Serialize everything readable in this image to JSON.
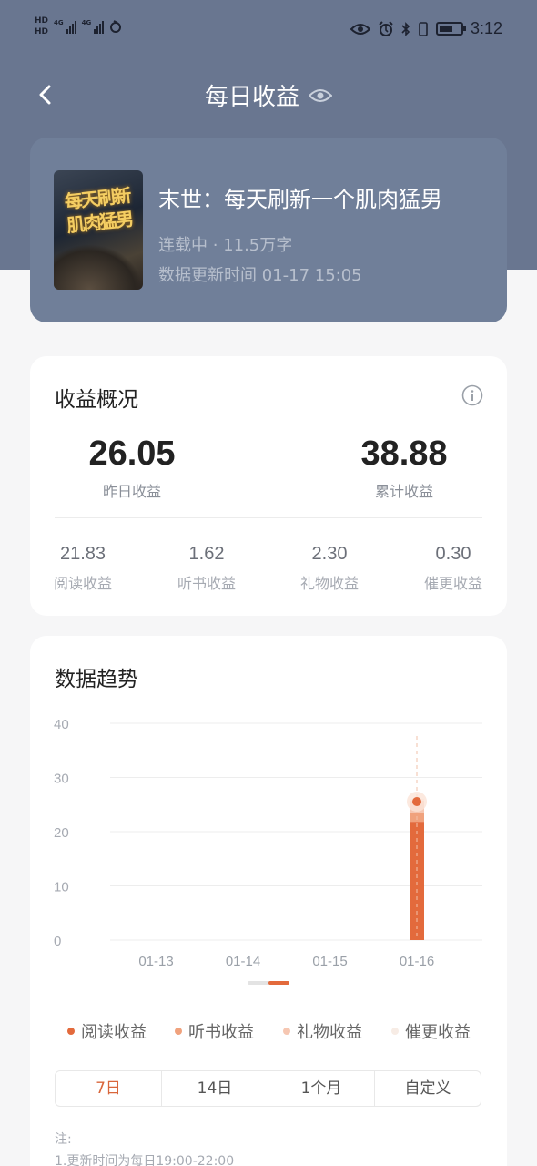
{
  "status_bar": {
    "network": [
      "HD",
      "HD"
    ],
    "sig1_label": "4G",
    "sig2_label": "4G",
    "time": "3:12",
    "icons": [
      "eye-icon",
      "alarm-icon",
      "bluetooth-icon",
      "vibrate-icon",
      "battery-icon"
    ]
  },
  "header": {
    "back_icon": "chevron-left-icon",
    "title": "每日收益",
    "title_icon": "eye-icon"
  },
  "book": {
    "title": "末世：每天刷新一个肌肉猛男",
    "status": "连载中 · 11.5万字",
    "updated": "数据更新时间 01-17 15:05",
    "cover_text": "每天刷新肌肉猛男"
  },
  "summary": {
    "title": "收益概况",
    "info_icon": "info-icon",
    "yesterday": {
      "value": "26.05",
      "label": "昨日收益"
    },
    "total": {
      "value": "38.88",
      "label": "累计收益"
    },
    "breakdown": [
      {
        "value": "21.83",
        "label": "阅读收益"
      },
      {
        "value": "1.62",
        "label": "听书收益"
      },
      {
        "value": "2.30",
        "label": "礼物收益"
      },
      {
        "value": "0.30",
        "label": "催更收益"
      }
    ]
  },
  "trend": {
    "title": "数据趋势",
    "tabs": [
      "7日",
      "14日",
      "1个月",
      "自定义"
    ],
    "active_tab": 0,
    "note_title": "注:",
    "note_line1": "1.更新时间为每日19:00-22:00"
  },
  "colors": {
    "header_bg": "#697690",
    "accent": "#d9663b",
    "read": "#e36a3c",
    "listen": "#f0a27d",
    "gift": "#f6c7b2",
    "urge": "#f7ece5"
  },
  "chart_data": {
    "type": "bar",
    "stacked": true,
    "categories": [
      "01-13",
      "01-14",
      "01-15",
      "01-16"
    ],
    "ylim": [
      0,
      40
    ],
    "yticks": [
      0,
      10,
      20,
      30,
      40
    ],
    "series": [
      {
        "name": "阅读收益",
        "color": "#e36a3c",
        "values": [
          0,
          0,
          0,
          21.83
        ]
      },
      {
        "name": "听书收益",
        "color": "#f0a27d",
        "values": [
          0,
          0,
          0,
          1.62
        ]
      },
      {
        "name": "礼物收益",
        "color": "#f6c7b2",
        "values": [
          0,
          0,
          0,
          2.3
        ]
      },
      {
        "name": "催更收益",
        "color": "#f7ece5",
        "values": [
          0,
          0,
          0,
          0.3
        ]
      }
    ],
    "highlight": {
      "category": "01-16",
      "value": 26.05
    },
    "grid": true,
    "legend": "bottom"
  }
}
